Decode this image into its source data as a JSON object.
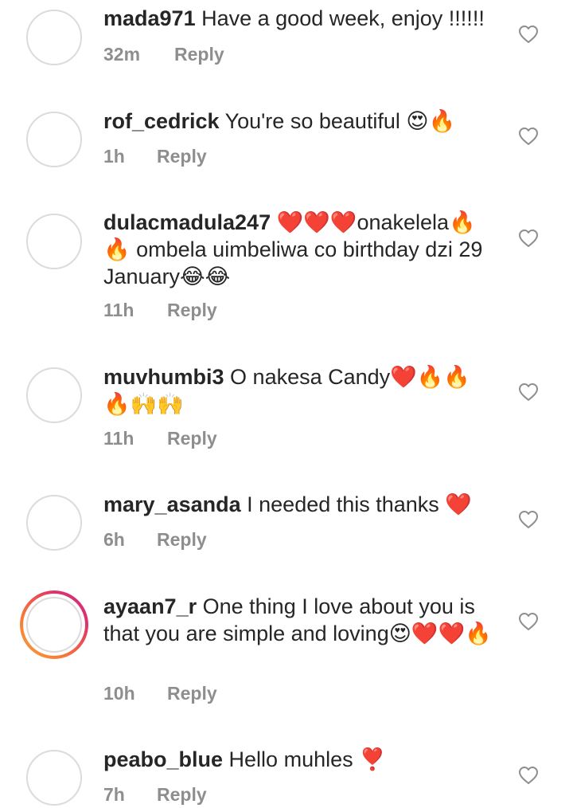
{
  "comments": [
    {
      "username": "mada971",
      "text": "Have a good week, enjoy !!!!!!",
      "time": "32m",
      "reply": "Reply",
      "story_ring": false
    },
    {
      "username": "rof_cedrick",
      "text": "You're so beautiful 😍🔥",
      "time": "1h",
      "reply": "Reply",
      "story_ring": false
    },
    {
      "username": "dulacmadula247",
      "text": "❤️❤️❤️onakelela🔥🔥 ombela uimbeliwa co birthday dzi 29 January😂😂",
      "time": "11h",
      "reply": "Reply",
      "story_ring": false
    },
    {
      "username": "muvhumbi3",
      "text": "O nakesa Candy❤️🔥🔥🔥🙌🙌",
      "time": "11h",
      "reply": "Reply",
      "story_ring": false
    },
    {
      "username": "mary_asanda",
      "text": "I needed this thanks ❤️",
      "time": "6h",
      "reply": "Reply",
      "story_ring": false
    },
    {
      "username": "ayaan7_r",
      "text": "One thing I love about you is that you are simple and loving😍❤️❤️🔥",
      "time": "10h",
      "reply": "Reply",
      "story_ring": true
    },
    {
      "username": "peabo_blue",
      "text": "Hello muhles ❣️",
      "time": "7h",
      "reply": "Reply",
      "story_ring": false
    }
  ],
  "icons": {
    "like": "heart-outline-icon"
  },
  "colors": {
    "text": "#262626",
    "meta": "#8e8e8e",
    "border": "#dbdbdb"
  }
}
